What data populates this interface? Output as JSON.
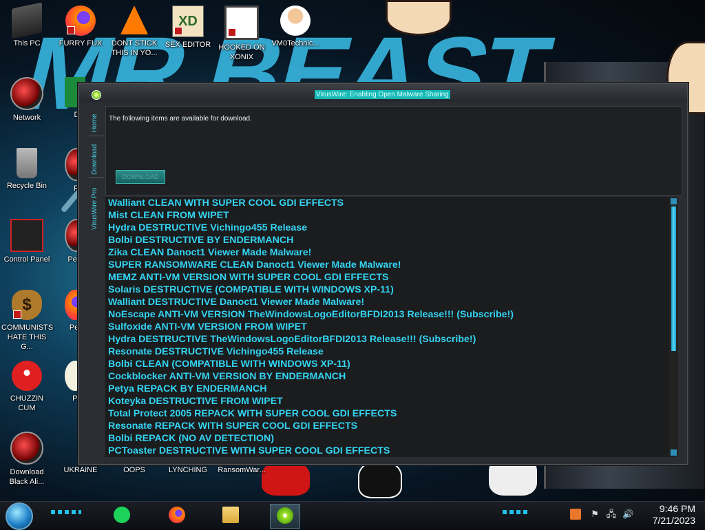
{
  "desktop": {
    "icons": [
      {
        "label": "This PC",
        "icon": "computer-icon"
      },
      {
        "label": "FURRY FUX",
        "icon": "firefox-icon"
      },
      {
        "label": "DONT STICK THIS IN YO...",
        "icon": "vlc-cone-icon"
      },
      {
        "label": "SEX EDITOR",
        "icon": "hxd-editor-icon"
      },
      {
        "label": "HOOKED ON XONIX",
        "icon": "maze-game-icon"
      },
      {
        "label": "VM0Technic...",
        "icon": "doctor-icon"
      },
      {
        "label": "Network",
        "icon": "network-icon"
      },
      {
        "label": "Recycle Bin",
        "icon": "recycle-bin-icon"
      },
      {
        "label": "Control Panel",
        "icon": "control-panel-icon"
      },
      {
        "label": "COMMUNISTS HATE THIS G...",
        "icon": "money-bag-icon"
      },
      {
        "label": "CHUZZIN CUM",
        "icon": "chuzzle-icon"
      },
      {
        "label": "Download Black Ali...",
        "icon": "download-icon"
      },
      {
        "label": "D DU",
        "icon": "app-icon"
      },
      {
        "label": "Peggl",
        "icon": "peggle-icon"
      },
      {
        "label": "Peggl De",
        "icon": "peggle-icon"
      },
      {
        "label": "Peggl of Wa",
        "icon": "peggle-icon"
      },
      {
        "label": "Pla Zo",
        "icon": "plants-icon"
      },
      {
        "label": "UKRAINE",
        "icon": "app-icon"
      },
      {
        "label": "OOPS",
        "icon": "app-icon"
      },
      {
        "label": "LYNCHING",
        "icon": "app-icon"
      },
      {
        "label": "RansomWar...",
        "icon": "app-icon"
      }
    ],
    "wallpaper_text": "MR BEAST"
  },
  "window": {
    "title": "VirusWire: Enabling Open Malware Sharing",
    "tabs": [
      "Home",
      "Download",
      "VirusWire Pro"
    ],
    "intro_text": "The following items are available for download.",
    "download_button": "DOWNLOAD",
    "items": [
      "Walliant CLEAN WITH SUPER COOL GDI EFFECTS",
      "Mist CLEAN FROM WIPET",
      "Hydra DESTRUCTIVE Vichingo455 Release",
      "Bolbi DESTRUCTIVE BY ENDERMANCH",
      "Zika CLEAN Danoct1 Viewer Made Malware!",
      "SUPER RANSOMWARE CLEAN Danoct1 Viewer Made Malware!",
      "MEMZ ANTI-VM VERSION WITH SUPER COOL GDI EFFECTS",
      "Solaris DESTRUCTIVE (COMPATIBLE WITH WINDOWS XP-11)",
      "Walliant DESTRUCTIVE Danoct1 Viewer Made Malware!",
      "NoEscape ANTI-VM VERSION TheWindowsLogoEditorBFDI2013 Release!!! (Subscribe!)",
      "Sulfoxide ANTI-VM VERSION FROM WIPET",
      "Hydra DESTRUCTIVE TheWindowsLogoEditorBFDI2013 Release!!! (Subscribe!)",
      "Resonate DESTRUCTIVE Vichingo455 Release",
      "Bolbi CLEAN (COMPATIBLE WITH WINDOWS XP-11)",
      "Cockblocker ANTI-VM VERSION BY ENDERMANCH",
      "Petya REPACK BY ENDERMANCH",
      "Koteyka DESTRUCTIVE FROM WIPET",
      "Total Protect 2005 REPACK WITH SUPER COOL GDI EFFECTS",
      "Resonate REPACK WITH SUPER COOL GDI EFFECTS",
      "Bolbi REPACK (NO AV DETECTION)",
      "PCToaster DESTRUCTIVE WITH SUPER COOL GDI EFFECTS"
    ]
  },
  "taskbar": {
    "apps": [
      "chat-app-icon",
      "firefox-icon",
      "file-explorer-icon",
      "viruswire-icon"
    ],
    "active_app": "viruswire-icon",
    "tray": {
      "flag": "⚑",
      "network": "🖧",
      "volume": "🔊"
    },
    "time": "9:46 PM",
    "date": "7/21/2023"
  },
  "colors": {
    "accent": "#33d4f2",
    "title_highlight": "#15b9b6",
    "window_bg": "#2a2d31",
    "list_bg": "#1b1c1e"
  }
}
